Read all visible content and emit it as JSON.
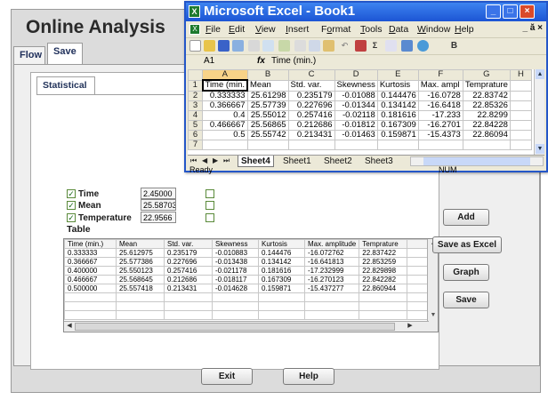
{
  "app": {
    "title": "Online Analysis",
    "tabs": [
      "Flow",
      "Save"
    ],
    "subtab": "Statistical",
    "checkboxes": [
      {
        "label": "Time",
        "value": "2.45000",
        "checked": true
      },
      {
        "label": "Mean",
        "value": "25.58703",
        "checked": true
      },
      {
        "label": "Temperature",
        "value": "22.9566",
        "checked": true
      }
    ],
    "table_heading": "Table",
    "table": {
      "headers": [
        "Time (min.)",
        "Mean",
        "Std. var.",
        "Skewness",
        "Kurtosis",
        "Max. amplitude",
        "Temprature"
      ],
      "rows": [
        [
          "0.333333",
          "25.612975",
          "0.235179",
          "-0.010883",
          "0.144476",
          "-16.072762",
          "22.837422"
        ],
        [
          "0.366667",
          "25.577386",
          "0.227696",
          "-0.013438",
          "0.134142",
          "-16.641813",
          "22.853259"
        ],
        [
          "0.400000",
          "25.550123",
          "0.257416",
          "-0.021178",
          "0.181616",
          "-17.232999",
          "22.829898"
        ],
        [
          "0.466667",
          "25.568645",
          "0.212686",
          "-0.018117",
          "0.167309",
          "-16.270123",
          "22.842282"
        ],
        [
          "0.500000",
          "25.557418",
          "0.213431",
          "-0.014628",
          "0.159871",
          "-15.437277",
          "22.860944"
        ]
      ]
    },
    "buttons": {
      "add": "Add",
      "save_as_excel": "Save as Excel",
      "graph": "Graph",
      "save": "Save",
      "exit": "Exit",
      "help": "Help"
    }
  },
  "excel": {
    "title": "Microsoft Excel - Book1",
    "menus": [
      {
        "u": "F",
        "rest": "ile"
      },
      {
        "u": "E",
        "rest": "dit"
      },
      {
        "u": "V",
        "rest": "iew"
      },
      {
        "u": "I",
        "rest": "nsert"
      },
      {
        "pre": "F",
        "u": "o",
        "rest": "rmat"
      },
      {
        "u": "T",
        "rest": "ools"
      },
      {
        "u": "D",
        "rest": "ata"
      },
      {
        "u": "W",
        "rest": "indow"
      },
      {
        "u": "H",
        "rest": "elp"
      }
    ],
    "menu_controls": "_ ă ×",
    "name_box": "A1",
    "fx": "fx",
    "formula": "Time (min.)",
    "columns": [
      "A",
      "B",
      "C",
      "D",
      "E",
      "F",
      "G",
      "H"
    ],
    "rows": [
      [
        "Time (min.",
        "Mean",
        "Std. var.",
        "Skewness",
        "Kurtosis",
        "Max. ampl",
        "Temprature",
        ""
      ],
      [
        "0.333333",
        "25.61298",
        "0.235179",
        "-0.01088",
        "0.144476",
        "-16.0728",
        "22.83742",
        ""
      ],
      [
        "0.366667",
        "25.57739",
        "0.227696",
        "-0.01344",
        "0.134142",
        "-16.6418",
        "22.85326",
        ""
      ],
      [
        "0.4",
        "25.55012",
        "0.257416",
        "-0.02118",
        "0.181616",
        "-17.233",
        "22.8299",
        ""
      ],
      [
        "0.466667",
        "25.56865",
        "0.212686",
        "-0.01812",
        "0.167309",
        "-16.2701",
        "22.84228",
        ""
      ],
      [
        "0.5",
        "25.55742",
        "0.213431",
        "-0.01463",
        "0.159871",
        "-15.4373",
        "22.86094",
        ""
      ],
      [
        "",
        "",
        "",
        "",
        "",
        "",
        "",
        ""
      ]
    ],
    "sheets": [
      "Sheet4",
      "Sheet1",
      "Sheet2",
      "Sheet3"
    ],
    "status_ready": "Ready",
    "status_num": "NUM"
  }
}
